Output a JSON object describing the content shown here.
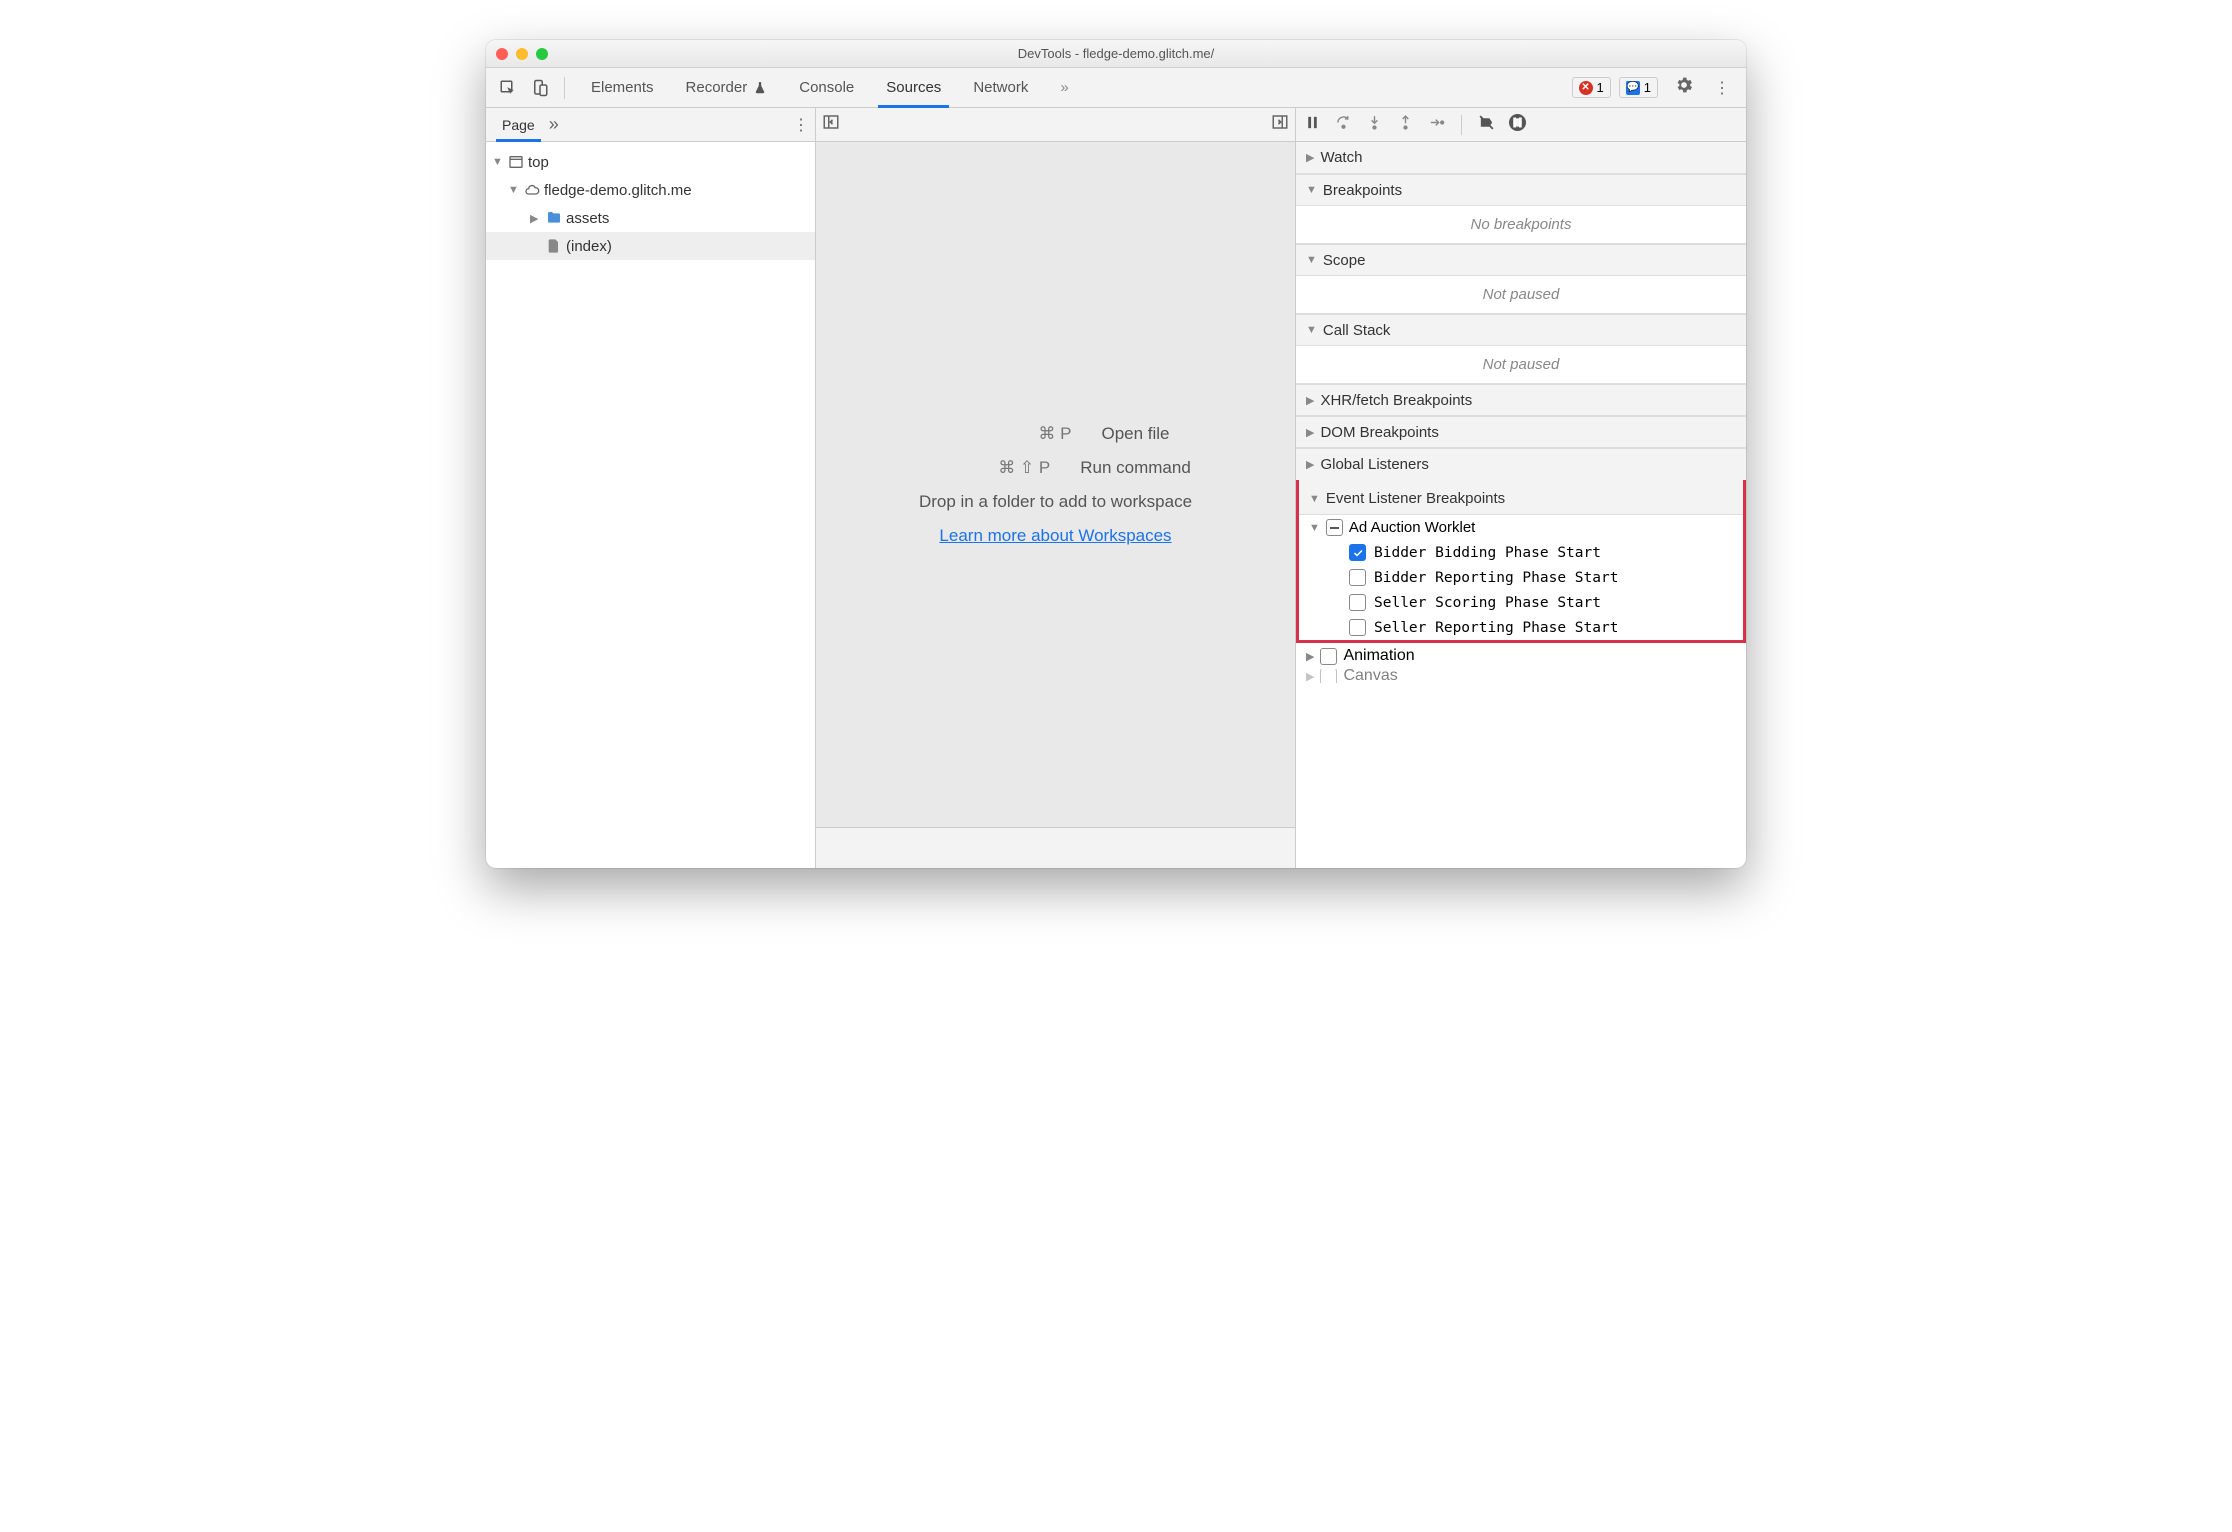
{
  "window": {
    "title": "DevTools - fledge-demo.glitch.me/"
  },
  "toolbar": {
    "tabs": [
      "Elements",
      "Recorder",
      "Console",
      "Sources",
      "Network"
    ],
    "activeTab": "Sources",
    "errorCount": "1",
    "issueCount": "1"
  },
  "leftPane": {
    "tab": "Page",
    "tree": {
      "top": "top",
      "domain": "fledge-demo.glitch.me",
      "folder": "assets",
      "file": "(index)"
    }
  },
  "midPane": {
    "openFileKey": "⌘ P",
    "openFileLabel": "Open file",
    "runCmdKey": "⌘ ⇧ P",
    "runCmdLabel": "Run command",
    "dropHint": "Drop in a folder to add to workspace",
    "learnMore": "Learn more about Workspaces"
  },
  "rightPane": {
    "watch": "Watch",
    "breakpoints": "Breakpoints",
    "noBreakpoints": "No breakpoints",
    "scope": "Scope",
    "notPaused": "Not paused",
    "callStack": "Call Stack",
    "xhr": "XHR/fetch Breakpoints",
    "dom": "DOM Breakpoints",
    "globalListeners": "Global Listeners",
    "eventListener": "Event Listener Breakpoints",
    "adAuction": {
      "name": "Ad Auction Worklet",
      "items": [
        {
          "label": "Bidder Bidding Phase Start",
          "checked": true
        },
        {
          "label": "Bidder Reporting Phase Start",
          "checked": false
        },
        {
          "label": "Seller Scoring Phase Start",
          "checked": false
        },
        {
          "label": "Seller Reporting Phase Start",
          "checked": false
        }
      ]
    },
    "animation": "Animation",
    "canvas": "Canvas"
  }
}
